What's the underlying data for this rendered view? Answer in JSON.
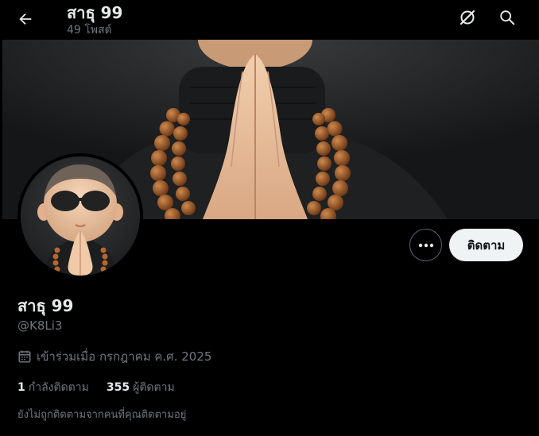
{
  "header": {
    "title": "สาธุ 99",
    "post_count": "49 โพสต์",
    "back_icon": "arrow-left-icon",
    "grok_icon": "grok-icon",
    "search_icon": "search-icon"
  },
  "profile": {
    "display_name": "สาธุ 99",
    "handle": "@K8Li3",
    "joined": "เข้าร่วมเมื่อ กรกฎาคม ค.ศ. 2025",
    "following_count": "1",
    "following_label": "กำลังติดตาม",
    "followers_count": "355",
    "followers_label": "ผู้ติดตาม",
    "not_followed_note": "ยังไม่ถูกติดตามจากคนที่คุณติดตามอยู่"
  },
  "actions": {
    "more_icon": "more-dots-icon",
    "follow_label": "ติดตาม"
  },
  "colors": {
    "background": "#000000",
    "text_primary": "#e7e9ea",
    "text_secondary": "#71767b",
    "follow_button_bg": "#eff3f4",
    "border": "#536471"
  }
}
